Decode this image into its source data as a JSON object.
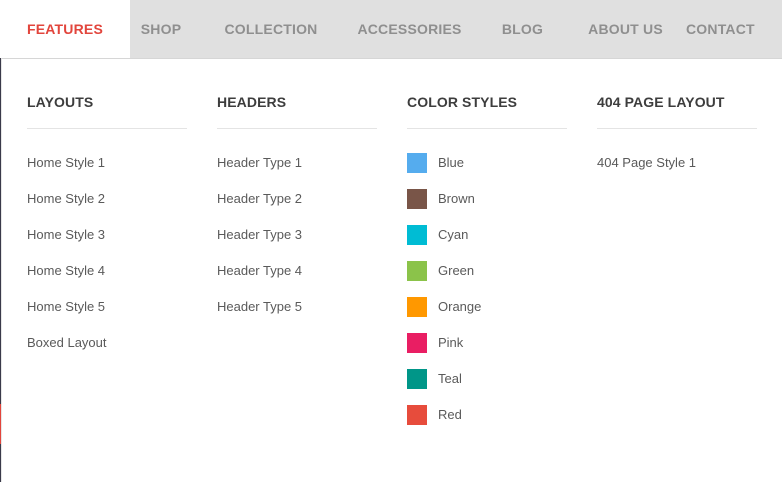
{
  "nav": {
    "items": [
      {
        "label": "FEATURES",
        "active": true
      },
      {
        "label": "SHOP",
        "active": false
      },
      {
        "label": "COLLECTION",
        "active": false
      },
      {
        "label": "ACCESSORIES",
        "active": false
      },
      {
        "label": "BLOG",
        "active": false
      },
      {
        "label": "ABOUT US",
        "active": false
      },
      {
        "label": "CONTACT",
        "active": false
      }
    ]
  },
  "menu": {
    "layouts": {
      "title": "LAYOUTS",
      "items": [
        "Home Style 1",
        "Home Style 2",
        "Home Style 3",
        "Home Style 4",
        "Home Style 5",
        "Boxed Layout"
      ]
    },
    "headers": {
      "title": "HEADERS",
      "items": [
        "Header Type 1",
        "Header Type 2",
        "Header Type 3",
        "Header Type 4",
        "Header Type 5"
      ]
    },
    "color_styles": {
      "title": "COLOR STYLES",
      "items": [
        {
          "label": "Blue",
          "color": "#55acee"
        },
        {
          "label": "Brown",
          "color": "#795548"
        },
        {
          "label": "Cyan",
          "color": "#00bcd4"
        },
        {
          "label": "Green",
          "color": "#8bc34a"
        },
        {
          "label": "Orange",
          "color": "#ff9800"
        },
        {
          "label": "Pink",
          "color": "#e91e63"
        },
        {
          "label": "Teal",
          "color": "#009688"
        },
        {
          "label": "Red",
          "color": "#e74c3c"
        }
      ]
    },
    "page404": {
      "title": "404 PAGE LAYOUT",
      "items": [
        "404 Page Style 1"
      ]
    }
  },
  "colors": {
    "accent": "#e2453c",
    "nav_bg": "#e0e0e0",
    "nav_text": "#8f8f8f"
  }
}
